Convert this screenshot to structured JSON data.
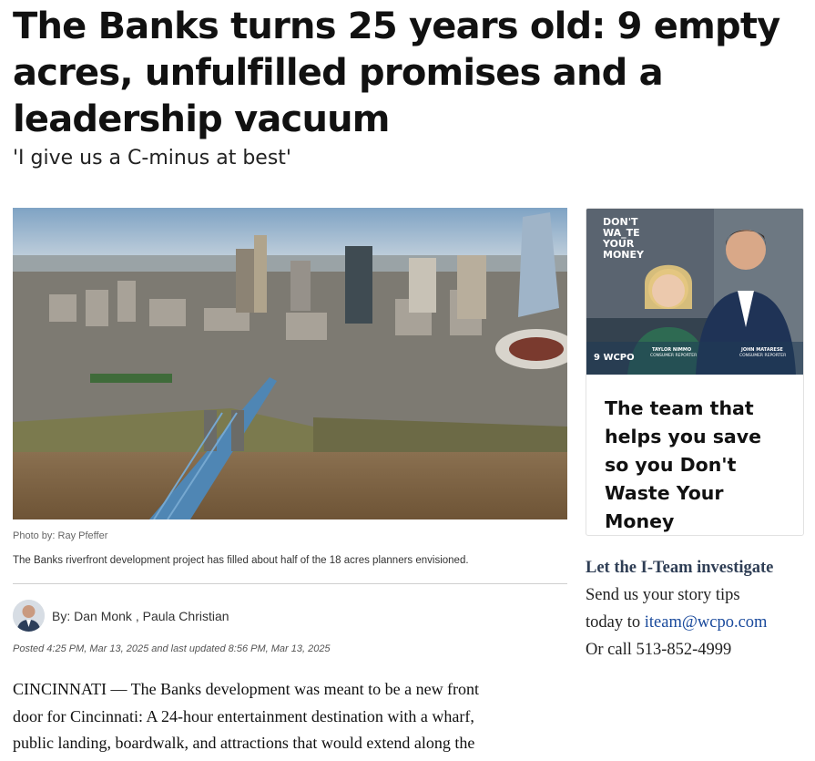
{
  "article": {
    "headline": "The Banks turns 25 years old: 9 empty acres, unfulfilled promises and a leadership vacuum",
    "subheadline": "'I give us a C-minus at best'",
    "photo_credit": "Photo by: Ray Pfeffer",
    "caption": "The Banks riverfront development project has filled about half of the 18 acres planners envisioned.",
    "byline_prefix": "By:",
    "authors": "Dan Monk , Paula Christian",
    "posted": "Posted 4:25 PM, Mar 13, 2025 and last updated 8:56 PM, Mar 13, 2025",
    "body_lines": [
      "CINCINNATI — The Banks development was meant to be a new front",
      "door for Cincinnati: A 24-hour entertainment destination with a wharf,",
      "public landing, boardwalk, and attractions that would extend along the"
    ]
  },
  "sidebar": {
    "promo": {
      "badge_lines": [
        "DON'T",
        "WA_TE",
        "YOUR",
        "MONEY"
      ],
      "station_logo": "9 WCPO",
      "person_left_name": "TAYLOR NIMMO",
      "person_left_role": "CONSUMER REPORTER",
      "person_right_name": "JOHN MATARESE",
      "person_right_role": "CONSUMER REPORTER",
      "text": "The team that helps you save so you Don't Waste Your Money"
    },
    "iteam": {
      "title": "Let the I-Team investigate",
      "line1": "Send us your story tips",
      "line2_prefix": "today to ",
      "email": "iteam@wcpo.com",
      "line3": "Or call 513-852-4999"
    }
  },
  "colors": {
    "iteam_title": "#2f3e55",
    "link": "#1a4a9c",
    "promo_bg": "#2c3a4c",
    "river": "#7a6040"
  }
}
